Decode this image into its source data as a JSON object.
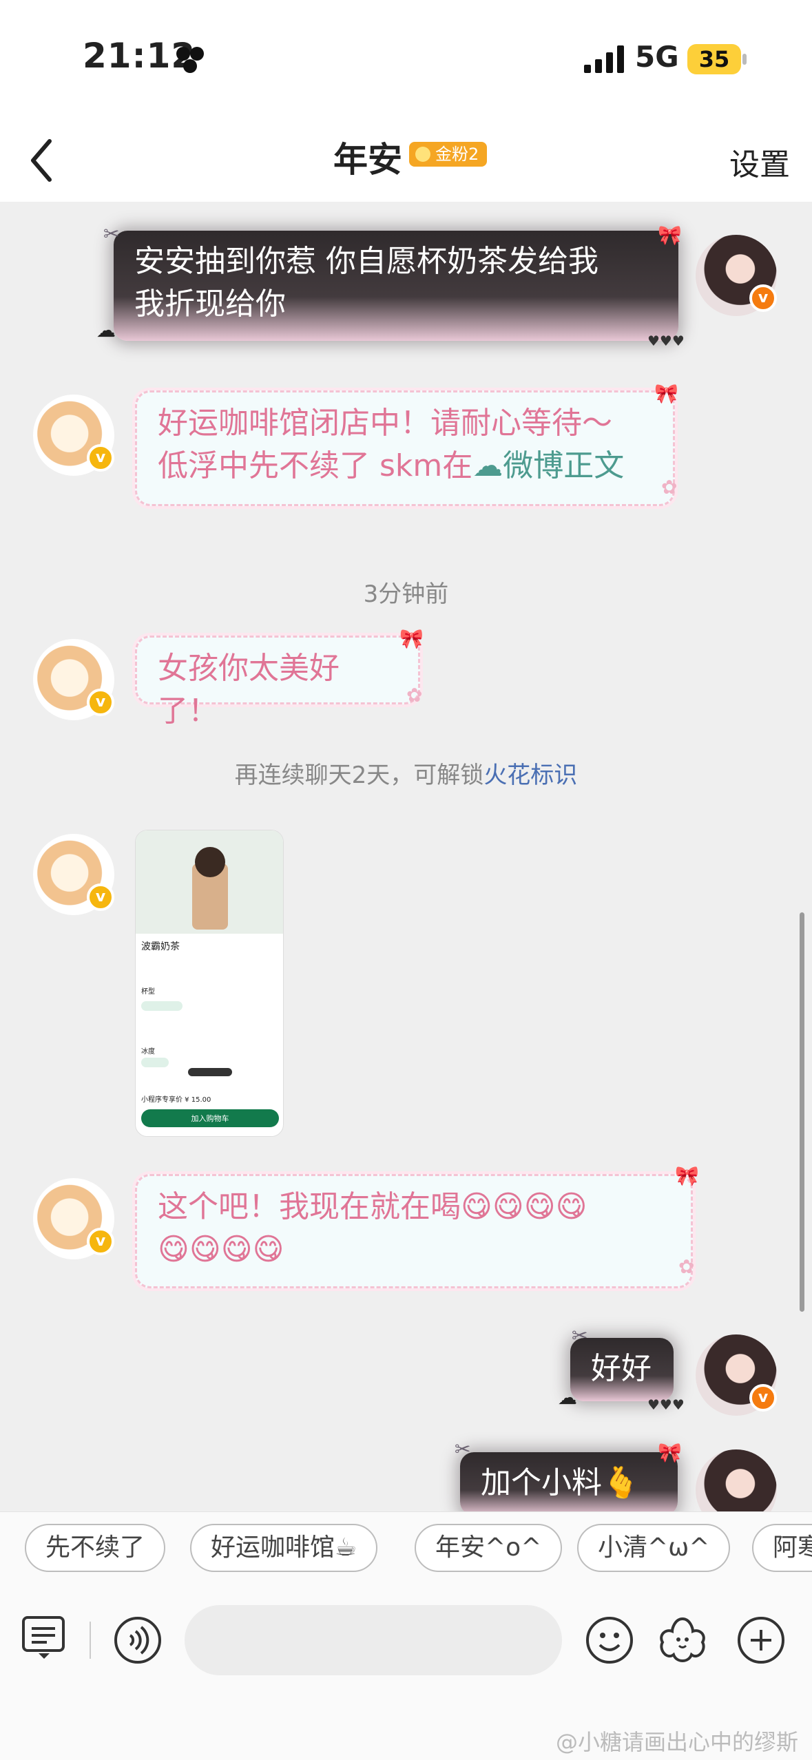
{
  "status": {
    "time": "21:12",
    "network": "5G",
    "battery": "35"
  },
  "header": {
    "title": "年安",
    "badge": "金粉2",
    "settings": "设置"
  },
  "messages": {
    "m1": {
      "line1": "安安抽到你惹 你自愿杯奶茶发给我",
      "line2": "我折现给你"
    },
    "m2": {
      "line1": "好运咖啡馆闭店中！请耐心等待～",
      "line2_a": "低浮中先不续了 skm在",
      "line2_link": "微博正文"
    },
    "time_divider": "3分钟前",
    "m3": "女孩你太美好了！",
    "spark": {
      "prefix": "再连续聊天2天，可解锁",
      "highlight": "火花标识"
    },
    "m5": {
      "line1": "这个吧！我现在就在喝😋😋😋😋",
      "line2": "😋😋😋😋"
    },
    "m6": "好好",
    "m7": "加个小料🫰"
  },
  "product_card": {
    "name": "波霸奶茶",
    "price": "小程序专享价 ¥ 15.00",
    "option1": "杯型",
    "option2": "冰度",
    "cta": "加入购物车"
  },
  "quick_replies": [
    "先不续了",
    "好运咖啡馆☕",
    "年安^o^",
    "小清^ω^",
    "阿寒"
  ],
  "watermark": "@小糖请画出心中的缪斯",
  "icons": {
    "back": "chevron-left-icon",
    "keyboard": "keyboard-icon",
    "voice": "voice-icon",
    "emoji": "emoji-icon",
    "sticker": "flower-sticker-icon",
    "plus": "plus-icon"
  },
  "colors": {
    "pink_text": "#e07596",
    "link": "#4d9b8f",
    "spark": "#4a6fb3",
    "badge": "#f5a623"
  }
}
